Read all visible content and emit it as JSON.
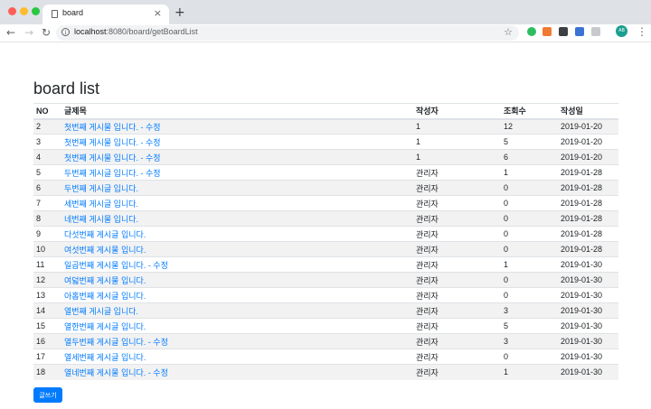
{
  "browser": {
    "tab_title": "board",
    "tab_close": "×",
    "new_tab": "+",
    "url_host": "localhost",
    "url_path": ":8080/board/getBoardList",
    "nav_back": "←",
    "nav_forward": "→",
    "nav_reload": "↻",
    "star": "☆",
    "menu": "⋮"
  },
  "page": {
    "title": "board list",
    "write_button": "글쓰기"
  },
  "table": {
    "headers": [
      "NO",
      "글제목",
      "작성자",
      "조회수",
      "작성일"
    ],
    "rows": [
      {
        "no": "2",
        "title": "첫번째 게시물 입니다. - 수정",
        "writer": "1",
        "views": "12",
        "date": "2019-01-20"
      },
      {
        "no": "3",
        "title": "첫번째 게시물 입니다. - 수정",
        "writer": "1",
        "views": "5",
        "date": "2019-01-20"
      },
      {
        "no": "4",
        "title": "첫번째 게시물 입니다. - 수정",
        "writer": "1",
        "views": "6",
        "date": "2019-01-20"
      },
      {
        "no": "5",
        "title": "두번째 게시글 입니다. - 수정",
        "writer": "관리자",
        "views": "1",
        "date": "2019-01-28"
      },
      {
        "no": "6",
        "title": "두번째 게시글 입니다.",
        "writer": "관리자",
        "views": "0",
        "date": "2019-01-28"
      },
      {
        "no": "7",
        "title": "세번째 게시글 입니다.",
        "writer": "관리자",
        "views": "0",
        "date": "2019-01-28"
      },
      {
        "no": "8",
        "title": "네번째 게시물 입니다.",
        "writer": "관리자",
        "views": "0",
        "date": "2019-01-28"
      },
      {
        "no": "9",
        "title": "다섯번째 게시글 입니다.",
        "writer": "관리자",
        "views": "0",
        "date": "2019-01-28"
      },
      {
        "no": "10",
        "title": "여섯번째 게시물 입니다.",
        "writer": "관리자",
        "views": "0",
        "date": "2019-01-28"
      },
      {
        "no": "11",
        "title": "일곱번째 게시물 입니다. - 수정",
        "writer": "관리자",
        "views": "1",
        "date": "2019-01-30"
      },
      {
        "no": "12",
        "title": "여덟번째 게시물 입니다.",
        "writer": "관리자",
        "views": "0",
        "date": "2019-01-30"
      },
      {
        "no": "13",
        "title": "아홉번째 게시글 입니다.",
        "writer": "관리자",
        "views": "0",
        "date": "2019-01-30"
      },
      {
        "no": "14",
        "title": "열번째 게시글 입니다.",
        "writer": "관리자",
        "views": "3",
        "date": "2019-01-30"
      },
      {
        "no": "15",
        "title": "열한번째 게시글 입니다.",
        "writer": "관리자",
        "views": "5",
        "date": "2019-01-30"
      },
      {
        "no": "16",
        "title": "열두번째 게시글 입니다. - 수정",
        "writer": "관리자",
        "views": "3",
        "date": "2019-01-30"
      },
      {
        "no": "17",
        "title": "열세번째 게시글 입니다.",
        "writer": "관리자",
        "views": "0",
        "date": "2019-01-30"
      },
      {
        "no": "18",
        "title": "열네번째 게시물 입니다. - 수정",
        "writer": "관리자",
        "views": "1",
        "date": "2019-01-30"
      }
    ]
  },
  "icons": {
    "info": "i",
    "avatar_text": "AB"
  }
}
